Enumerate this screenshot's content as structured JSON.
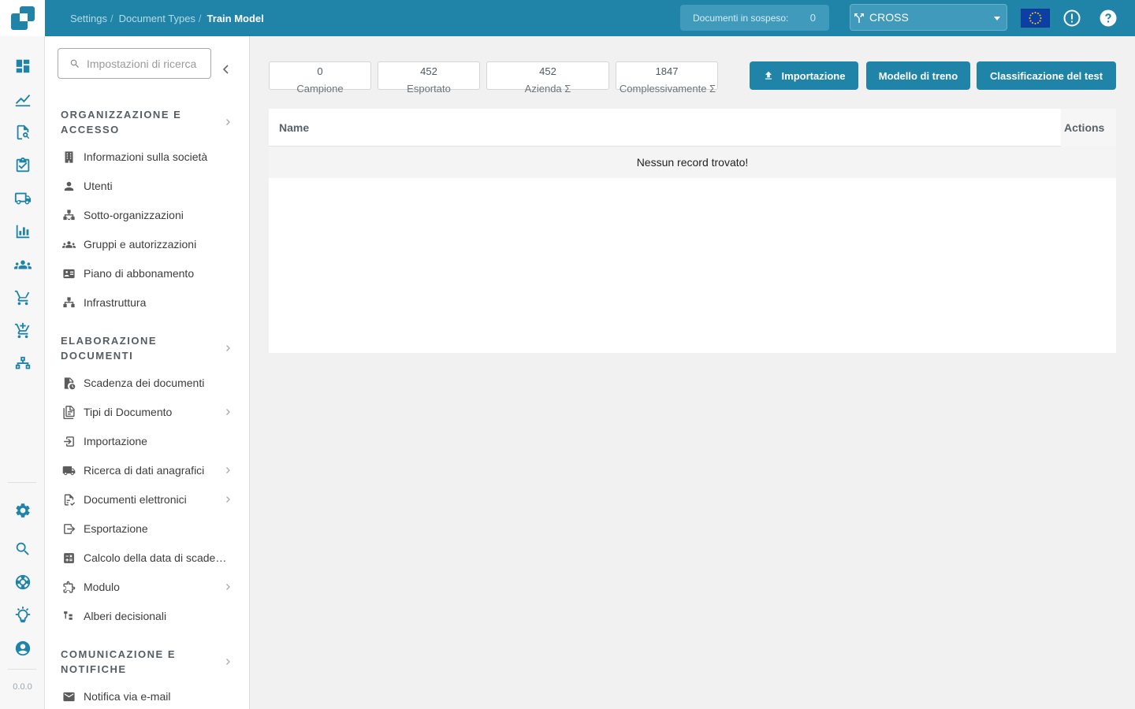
{
  "app": {
    "version": "0.0.0"
  },
  "colors": {
    "primary": "#1f84a8",
    "topbar": "#1f84a8",
    "pending_bg": "#3f9abb",
    "flag": "#0b3fa6"
  },
  "rail": {
    "icons": [
      "dashboard-icon",
      "chart-line-icon",
      "document-search-icon",
      "clipboard-check-icon",
      "truck-fast-icon",
      "bar-chart-icon",
      "users-icon",
      "cart-icon",
      "cart-plus-icon",
      "network-icon",
      "gear-icon",
      "search-icon",
      "lifebuoy-icon",
      "lightbulb-icon",
      "account-circle-icon"
    ]
  },
  "topbar": {
    "breadcrumb": [
      "Settings",
      "Document Types",
      "Train Model"
    ],
    "pending_label": "Documenti in sospeso:",
    "pending_count": "0",
    "tenant": "CROSS",
    "icons": [
      "eu-flag-icon",
      "alert-circle-icon",
      "help-circle-icon"
    ]
  },
  "sidebar": {
    "search_placeholder": "Impostazioni di ricerca",
    "sections": [
      {
        "title": "Organizzazione e accesso",
        "items": [
          {
            "label": "Informazioni sulla società",
            "icon": "building-icon"
          },
          {
            "label": "Utenti",
            "icon": "user-icon"
          },
          {
            "label": "Sotto-organizzazioni",
            "icon": "sitemap-icon"
          },
          {
            "label": "Gruppi e autorizzazioni",
            "icon": "users-group-icon"
          },
          {
            "label": "Piano di abbonamento",
            "icon": "id-card-icon"
          },
          {
            "label": "Infrastruttura",
            "icon": "sitemap-icon"
          }
        ]
      },
      {
        "title": "Elaborazione documenti",
        "items": [
          {
            "label": "Scadenza dei documenti",
            "icon": "file-clock-icon"
          },
          {
            "label": "Tipi di Documento",
            "icon": "file-document-icon",
            "has_children": true
          },
          {
            "label": "Importazione",
            "icon": "import-icon"
          },
          {
            "label": "Ricerca di dati anagrafici",
            "icon": "truck-icon",
            "has_children": true
          },
          {
            "label": "Documenti elettronici",
            "icon": "file-check-icon",
            "has_children": true
          },
          {
            "label": "Esportazione",
            "icon": "export-icon"
          },
          {
            "label": "Calcolo della data di scadenza",
            "icon": "calculator-icon"
          },
          {
            "label": "Modulo",
            "icon": "puzzle-icon",
            "has_children": true
          },
          {
            "label": "Alberi decisionali",
            "icon": "file-tree-icon"
          }
        ]
      },
      {
        "title": "Comunicazione e notifiche",
        "items": [
          {
            "label": "Notifica via e-mail",
            "icon": "email-icon"
          }
        ]
      }
    ]
  },
  "main": {
    "stats": [
      {
        "value": "0",
        "label": "Campione"
      },
      {
        "value": "452",
        "label": "Esportato"
      },
      {
        "value": "452",
        "label": "Azienda Σ"
      },
      {
        "value": "1847",
        "label": "Complessivamente Σ"
      }
    ],
    "buttons": {
      "import": "Importazione",
      "train": "Modello di treno",
      "test": "Classificazione del test"
    },
    "table": {
      "columns": [
        "Name",
        "Actions"
      ],
      "empty_message": "Nessun record trovato!"
    }
  }
}
